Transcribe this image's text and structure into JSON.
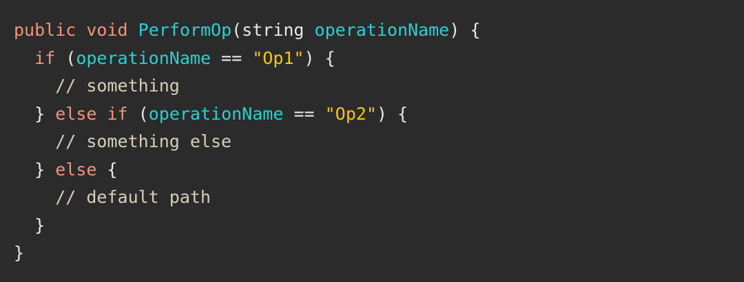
{
  "code": {
    "language": "C#",
    "lines": [
      {
        "tokens": [
          {
            "type": "kw",
            "text": "public"
          },
          {
            "type": "plain",
            "text": " "
          },
          {
            "type": "kw",
            "text": "void"
          },
          {
            "type": "plain",
            "text": " "
          },
          {
            "type": "fn",
            "text": "PerformOp"
          },
          {
            "type": "plain",
            "text": "(string "
          },
          {
            "type": "param",
            "text": "operationName"
          },
          {
            "type": "plain",
            "text": ") {"
          }
        ]
      },
      {
        "tokens": [
          {
            "type": "plain",
            "text": "  "
          },
          {
            "type": "kw",
            "text": "if"
          },
          {
            "type": "plain",
            "text": " ("
          },
          {
            "type": "param",
            "text": "operationName"
          },
          {
            "type": "op",
            "text": " == "
          },
          {
            "type": "str",
            "text": "\"Op1\""
          },
          {
            "type": "plain",
            "text": ") {"
          }
        ]
      },
      {
        "tokens": [
          {
            "type": "plain",
            "text": "    "
          },
          {
            "type": "comment",
            "text": "// something"
          }
        ]
      },
      {
        "tokens": [
          {
            "type": "plain",
            "text": "  } "
          },
          {
            "type": "kw",
            "text": "else"
          },
          {
            "type": "plain",
            "text": " "
          },
          {
            "type": "kw",
            "text": "if"
          },
          {
            "type": "plain",
            "text": " ("
          },
          {
            "type": "param",
            "text": "operationName"
          },
          {
            "type": "op",
            "text": " == "
          },
          {
            "type": "str",
            "text": "\"Op2\""
          },
          {
            "type": "plain",
            "text": ") {"
          }
        ]
      },
      {
        "tokens": [
          {
            "type": "plain",
            "text": "    "
          },
          {
            "type": "comment",
            "text": "// something else"
          }
        ]
      },
      {
        "tokens": [
          {
            "type": "plain",
            "text": "  } "
          },
          {
            "type": "kw",
            "text": "else"
          },
          {
            "type": "plain",
            "text": " {"
          }
        ]
      },
      {
        "tokens": [
          {
            "type": "plain",
            "text": "    "
          },
          {
            "type": "comment",
            "text": "// default path"
          }
        ]
      },
      {
        "tokens": [
          {
            "type": "plain",
            "text": "  }"
          }
        ]
      },
      {
        "tokens": [
          {
            "type": "plain",
            "text": "}"
          }
        ]
      }
    ]
  },
  "colors": {
    "background": "#2b2b2b",
    "keyword": "#f0957a",
    "identifier": "#2ccfd4",
    "string": "#f5c518",
    "comment": "#d6cfb8",
    "plain": "#e8e8e8"
  }
}
